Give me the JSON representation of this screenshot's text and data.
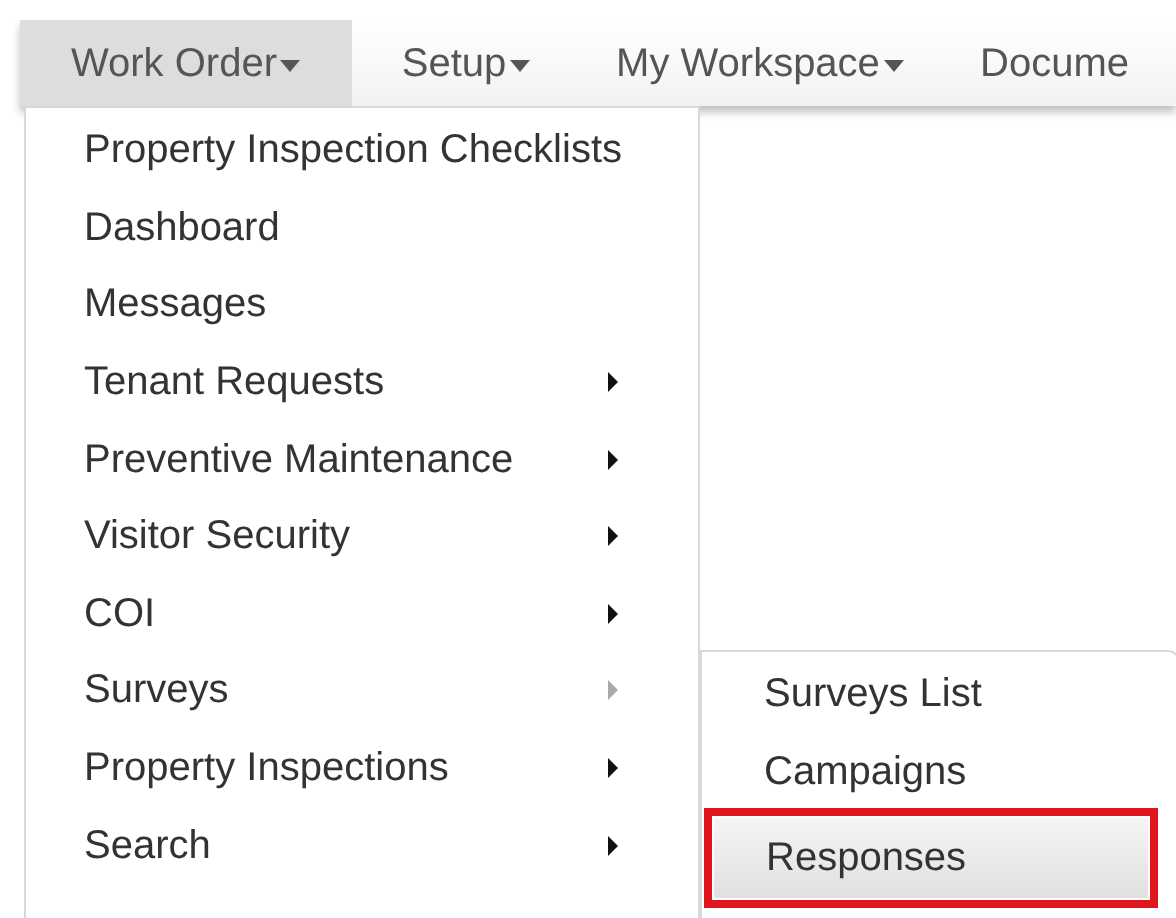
{
  "navbar": [
    {
      "label": "Work Order",
      "selected": true,
      "caret": true
    },
    {
      "label": "Setup",
      "selected": false,
      "caret": true
    },
    {
      "label": "My Workspace",
      "selected": false,
      "caret": true
    },
    {
      "label": "Docume",
      "selected": false,
      "caret": false
    }
  ],
  "menu": [
    {
      "label": "Property Inspection Checklists",
      "submenu": false
    },
    {
      "label": "Dashboard",
      "submenu": false
    },
    {
      "label": "Messages",
      "submenu": false
    },
    {
      "label": "Tenant Requests",
      "submenu": true,
      "expanded": false
    },
    {
      "label": "Preventive Maintenance",
      "submenu": true,
      "expanded": false
    },
    {
      "label": "Visitor Security",
      "submenu": true,
      "expanded": false
    },
    {
      "label": "COI",
      "submenu": true,
      "expanded": false
    },
    {
      "label": "Surveys",
      "submenu": true,
      "expanded": true
    },
    {
      "label": "Property Inspections",
      "submenu": true,
      "expanded": false
    },
    {
      "label": "Search",
      "submenu": true,
      "expanded": false
    }
  ],
  "submenu": [
    {
      "label": "Surveys List",
      "selected": false,
      "highlighted": false
    },
    {
      "label": "Campaigns",
      "selected": false,
      "highlighted": false
    },
    {
      "label": "Responses",
      "selected": true,
      "highlighted": true
    }
  ]
}
